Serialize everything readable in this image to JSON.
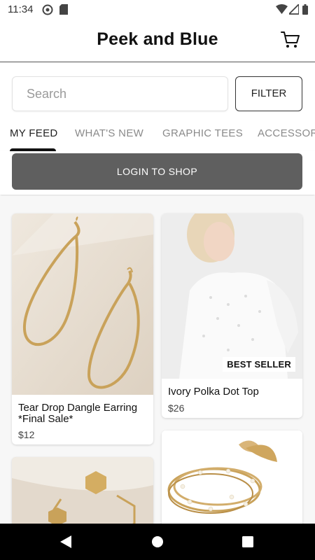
{
  "status_bar": {
    "time": "11:34",
    "left_icons": [
      "at-sign-icon",
      "sd-card-icon"
    ],
    "right_icons": [
      "wifi-icon",
      "signal-icon",
      "battery-icon"
    ]
  },
  "header": {
    "title": "Peek and Blue",
    "cart_icon": "cart-icon"
  },
  "search": {
    "placeholder": "Search",
    "value": "",
    "filter_label": "FILTER"
  },
  "tabs": [
    {
      "label": "MY FEED",
      "active": true
    },
    {
      "label": "WHAT'S NEW",
      "active": false
    },
    {
      "label": "GRAPHIC TEES",
      "active": false
    },
    {
      "label": "ACCESSORIES",
      "active": false
    }
  ],
  "login_button": "LOGIN TO SHOP",
  "products": [
    {
      "name": "Tear Drop Dangle Earring *Final Sale*",
      "price": "$12",
      "badge": ""
    },
    {
      "name": "Ivory Polka Dot Top",
      "price": "$26",
      "badge": "BEST SELLER"
    },
    {
      "name": "",
      "price": "",
      "badge": ""
    },
    {
      "name": "",
      "price": "",
      "badge": ""
    }
  ],
  "nav_bar": {
    "icons": [
      "back-icon",
      "home-icon",
      "recents-icon"
    ]
  },
  "colors": {
    "login_button_bg": "#5f5f5f",
    "tab_active": "#222222",
    "tab_inactive": "#8a8a8a",
    "feed_bg": "#f7f7f7"
  }
}
